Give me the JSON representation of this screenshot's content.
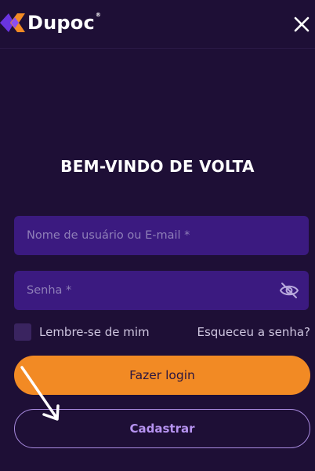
{
  "header": {
    "brand": "Dupoc",
    "brand_mark": "®",
    "logo_icon": "dupoc-logo-icon",
    "close_icon": "close-icon"
  },
  "title": "BEM-VINDO DE VOLTA",
  "form": {
    "username": {
      "placeholder": "Nome de usuário ou E-mail *",
      "value": ""
    },
    "password": {
      "placeholder": "Senha *",
      "value": "",
      "toggle_icon": "eye-off-icon"
    },
    "remember_label": "Lembre-se de mim",
    "forgot_label": "Esqueceu a senha?"
  },
  "actions": {
    "login_label": "Fazer login",
    "register_label": "Cadastrar"
  },
  "annotation": {
    "icon": "arrow-annotation-icon"
  },
  "colors": {
    "background": "#1e0f36",
    "input_bg": "#3b1a80",
    "primary": "#f28a24",
    "accent_outline": "#a98be0",
    "accent_text": "#b693f0",
    "logo_purple": "#6a34e0",
    "logo_orange": "#f28a24"
  }
}
